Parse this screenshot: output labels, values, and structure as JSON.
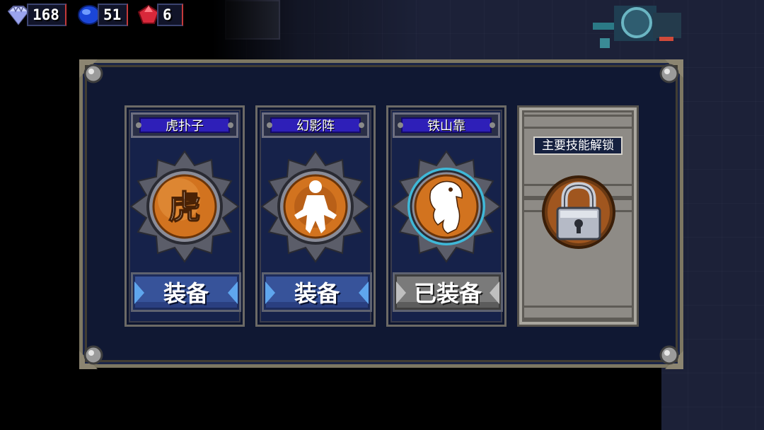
{
  "hud": {
    "gems": {
      "value": "168",
      "icon": "diamond-gem-icon"
    },
    "sapphires": {
      "value": "51",
      "icon": "blue-sapphire-icon"
    },
    "rubies": {
      "value": "6",
      "icon": "red-ruby-icon"
    }
  },
  "skills": [
    {
      "name": "虎扑子",
      "button": "装备",
      "state": "equip",
      "emblem": "tiger-character-emblem-icon"
    },
    {
      "name": "幻影阵",
      "button": "装备",
      "state": "equip",
      "emblem": "phantom-martial-artist-emblem-icon"
    },
    {
      "name": "铁山靠",
      "button": "已装备",
      "state": "equipped",
      "emblem": "iron-mountain-figure-emblem-icon"
    }
  ],
  "locked": {
    "label": "主要技能解锁",
    "icon": "padlock-icon"
  },
  "colors": {
    "equip_blue": "#37539a",
    "equipped_gray": "#7a7a7a",
    "title_purple": "#2e1fb8",
    "medal_orange": "#d2731f"
  }
}
